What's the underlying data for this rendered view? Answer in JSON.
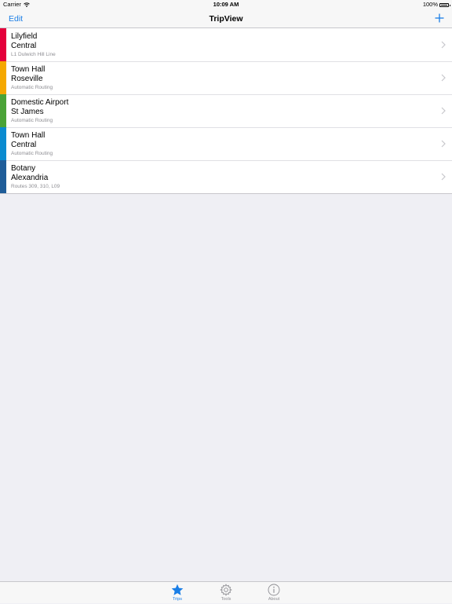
{
  "status_bar": {
    "carrier": "Carrier",
    "time": "10:09 AM",
    "battery": "100%",
    "battery_level": 1.0
  },
  "nav": {
    "edit_label": "Edit",
    "title": "TripView",
    "add_icon": "plus-icon"
  },
  "trips": [
    {
      "from": "Lilyfield",
      "to": "Central",
      "sub": "L1 Dulwich Hill Line",
      "color": "#e4003b"
    },
    {
      "from": "Town Hall",
      "to": "Roseville",
      "sub": "Automatic Routing",
      "color": "#f5a800"
    },
    {
      "from": "Domestic Airport",
      "to": "St James",
      "sub": "Automatic Routing",
      "color": "#4aa337"
    },
    {
      "from": "Town Hall",
      "to": "Central",
      "sub": "Automatic Routing",
      "color": "#0a8bd0"
    },
    {
      "from": "Botany",
      "to": "Alexandria",
      "sub": "Routes 309, 310, L09",
      "color": "#1f5d99"
    }
  ],
  "tabs": [
    {
      "label": "Trips",
      "icon": "star-icon",
      "active": true
    },
    {
      "label": "Tools",
      "icon": "gear-icon",
      "active": false
    },
    {
      "label": "About",
      "icon": "info-icon",
      "active": false
    }
  ],
  "colors": {
    "accent": "#1a7ee6",
    "background": "#efeff4",
    "bar_background": "#f7f7f7",
    "secondary_text": "#8e8e93"
  }
}
